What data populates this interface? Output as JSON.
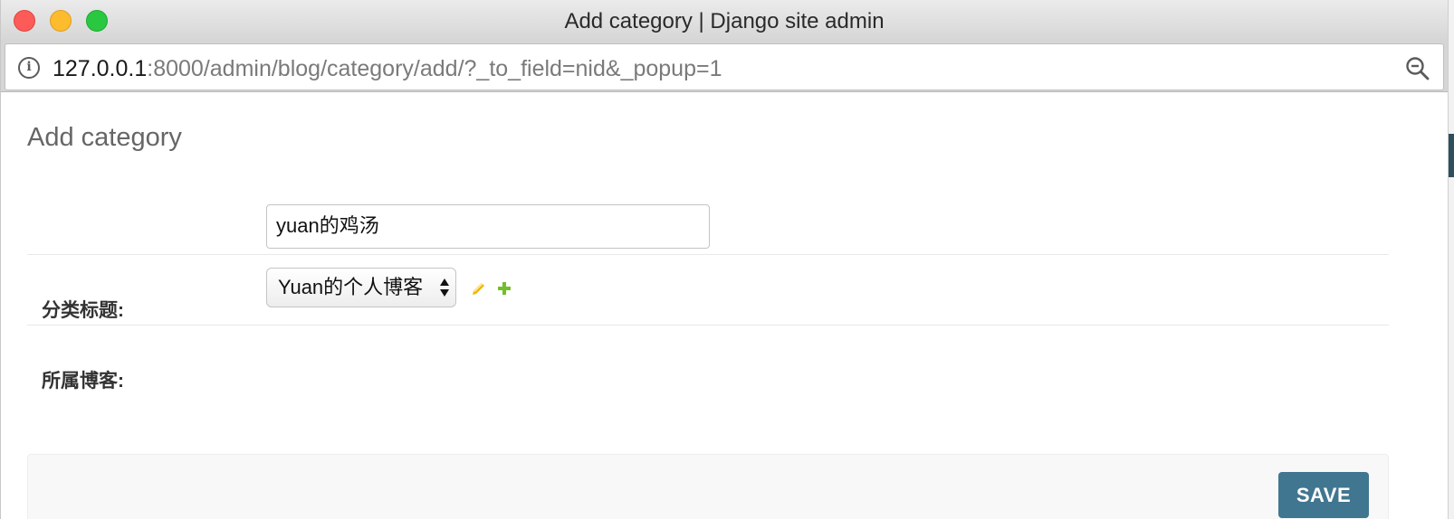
{
  "window": {
    "title": "Add category | Django site admin"
  },
  "address_bar": {
    "url_host": "127.0.0.1",
    "url_rest": ":8000/admin/blog/category/add/?_to_field=nid&_popup=1"
  },
  "page": {
    "title": "Add category",
    "fields": {
      "title_label": "分类标题:",
      "title_value": "yuan的鸡汤",
      "blog_label": "所属博客:",
      "blog_selected": "Yuan的个人博客"
    },
    "save_label": "SAVE"
  },
  "colors": {
    "save_button": "#417690",
    "edit_icon": "#efb80b",
    "add_icon": "#70bf2b"
  },
  "icons": [
    "info-icon",
    "zoom-out-icon",
    "pencil-icon",
    "plus-icon",
    "select-arrows-icon"
  ]
}
